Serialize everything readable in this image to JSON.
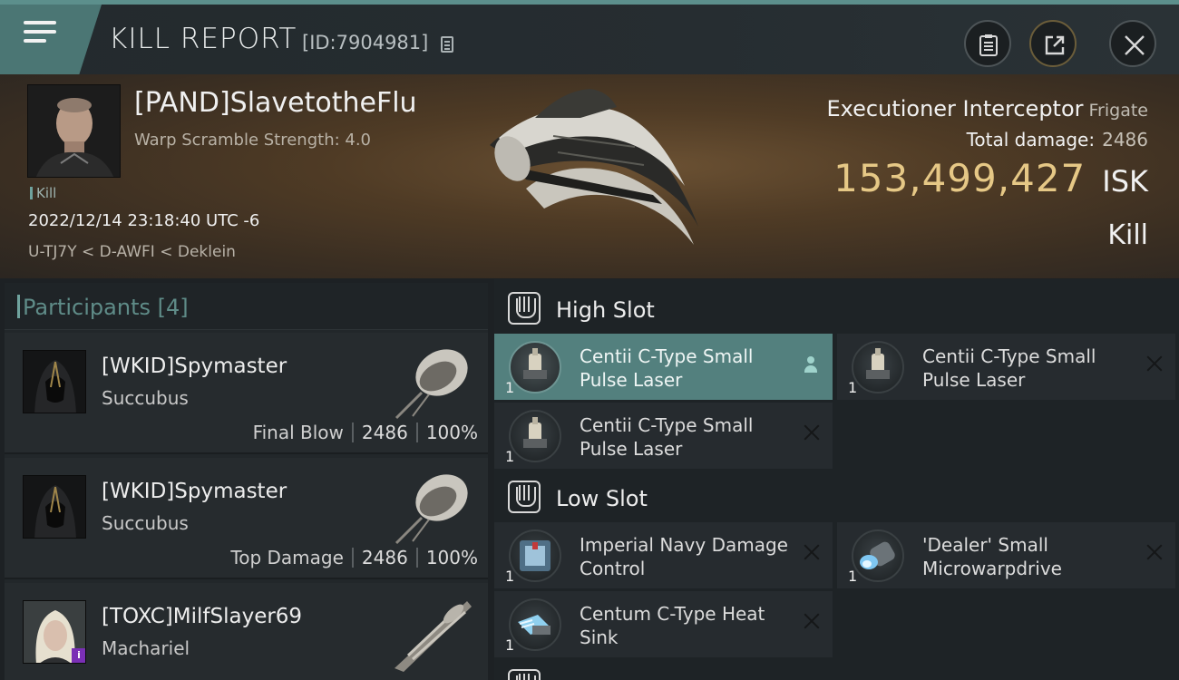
{
  "header": {
    "title": "KILL REPORT",
    "id_text": "[ID:7904981]"
  },
  "victim": {
    "name": "[PAND]SlavetotheFlu",
    "warp_scramble": "Warp Scramble Strength: 4.0",
    "tag": "Kill",
    "timestamp": "2022/12/14 23:18:40 UTC -6",
    "location": "U-TJ7Y < D-AWFI < Deklein",
    "ship_name": "Executioner Interceptor",
    "ship_class": "Frigate",
    "total_damage_label": "Total damage:",
    "total_damage": "2486",
    "isk_value": "153,499,427",
    "isk_unit": "ISK",
    "kill_type": "Kill"
  },
  "participants": {
    "title": "Participants [4]",
    "rows": [
      {
        "name": "[WKID]Spymaster",
        "ship": "Succubus",
        "label": "Final Blow",
        "damage": "2486",
        "percent": "100%"
      },
      {
        "name": "[WKID]Spymaster",
        "ship": "Succubus",
        "label": "Top Damage",
        "damage": "2486",
        "percent": "100%"
      },
      {
        "name": "[TOXC]MilfSlayer69",
        "ship": "Machariel",
        "badge": "i"
      }
    ]
  },
  "fitting": {
    "high_slot": {
      "title": "High Slot",
      "modules": [
        {
          "qty": "1",
          "name": "Centii C-Type Small Pulse Laser"
        },
        {
          "qty": "1",
          "name": "Centii C-Type Small Pulse Laser"
        },
        {
          "qty": "1",
          "name": "Centii C-Type Small Pulse Laser"
        }
      ]
    },
    "low_slot": {
      "title": "Low Slot",
      "modules": [
        {
          "qty": "1",
          "name": "Imperial Navy Damage Control"
        },
        {
          "qty": "1",
          "name": "'Dealer' Small Microwarpdrive"
        },
        {
          "qty": "1",
          "name": "Centum C-Type Heat Sink"
        }
      ]
    }
  },
  "colors": {
    "accent": "#4b7674",
    "isk_gold": "#e6c886",
    "selected_module": "#53807e"
  }
}
